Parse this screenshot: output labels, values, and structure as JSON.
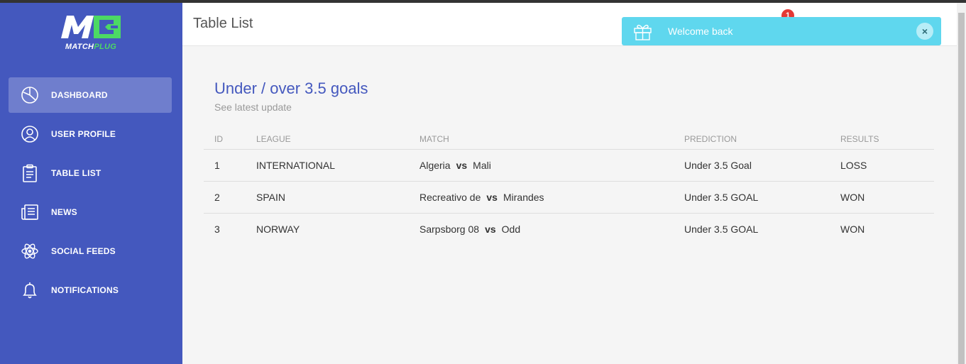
{
  "brand": {
    "logo_mark": "M",
    "name_part1": "MATCH",
    "name_part2": "PLUG",
    "accent_color": "#4cd964"
  },
  "sidebar": {
    "items": [
      {
        "label": "DASHBOARD",
        "icon": "pie-chart-icon",
        "active": true
      },
      {
        "label": "USER PROFILE",
        "icon": "user-icon",
        "active": false
      },
      {
        "label": "TABLE LIST",
        "icon": "clipboard-icon",
        "active": false
      },
      {
        "label": "NEWS",
        "icon": "newspaper-icon",
        "active": false
      },
      {
        "label": "SOCIAL FEEDS",
        "icon": "atom-icon",
        "active": false
      },
      {
        "label": "NOTIFICATIONS",
        "icon": "bell-icon",
        "active": false
      }
    ]
  },
  "header": {
    "title": "Table List",
    "notification_count": "1"
  },
  "toast": {
    "message": "Welcome back",
    "close": "×",
    "icon": "gift-icon"
  },
  "card": {
    "title": "Under / over 3.5 goals",
    "subtitle": "See latest update",
    "columns": [
      "ID",
      "LEAGUE",
      "MATCH",
      "PREDICTION",
      "RESULTS"
    ],
    "rows": [
      {
        "id": "1",
        "league": "INTERNATIONAL",
        "home": "Algeria",
        "vs": "vs",
        "away": "Mali",
        "prediction": "Under 3.5 Goal",
        "result": "LOSS"
      },
      {
        "id": "2",
        "league": "SPAIN",
        "home": "Recreativo de",
        "vs": "vs",
        "away": "Mirandes",
        "prediction": "Under 3.5 GOAL",
        "result": "WON"
      },
      {
        "id": "3",
        "league": "NORWAY",
        "home": "Sarpsborg 08",
        "vs": "vs",
        "away": "Odd",
        "prediction": "Under 3.5 GOAL",
        "result": "WON"
      }
    ]
  },
  "colors": {
    "sidebar": "#4458be",
    "title": "#4458be",
    "toast": "#5fd7ee",
    "badge": "#e53935"
  }
}
